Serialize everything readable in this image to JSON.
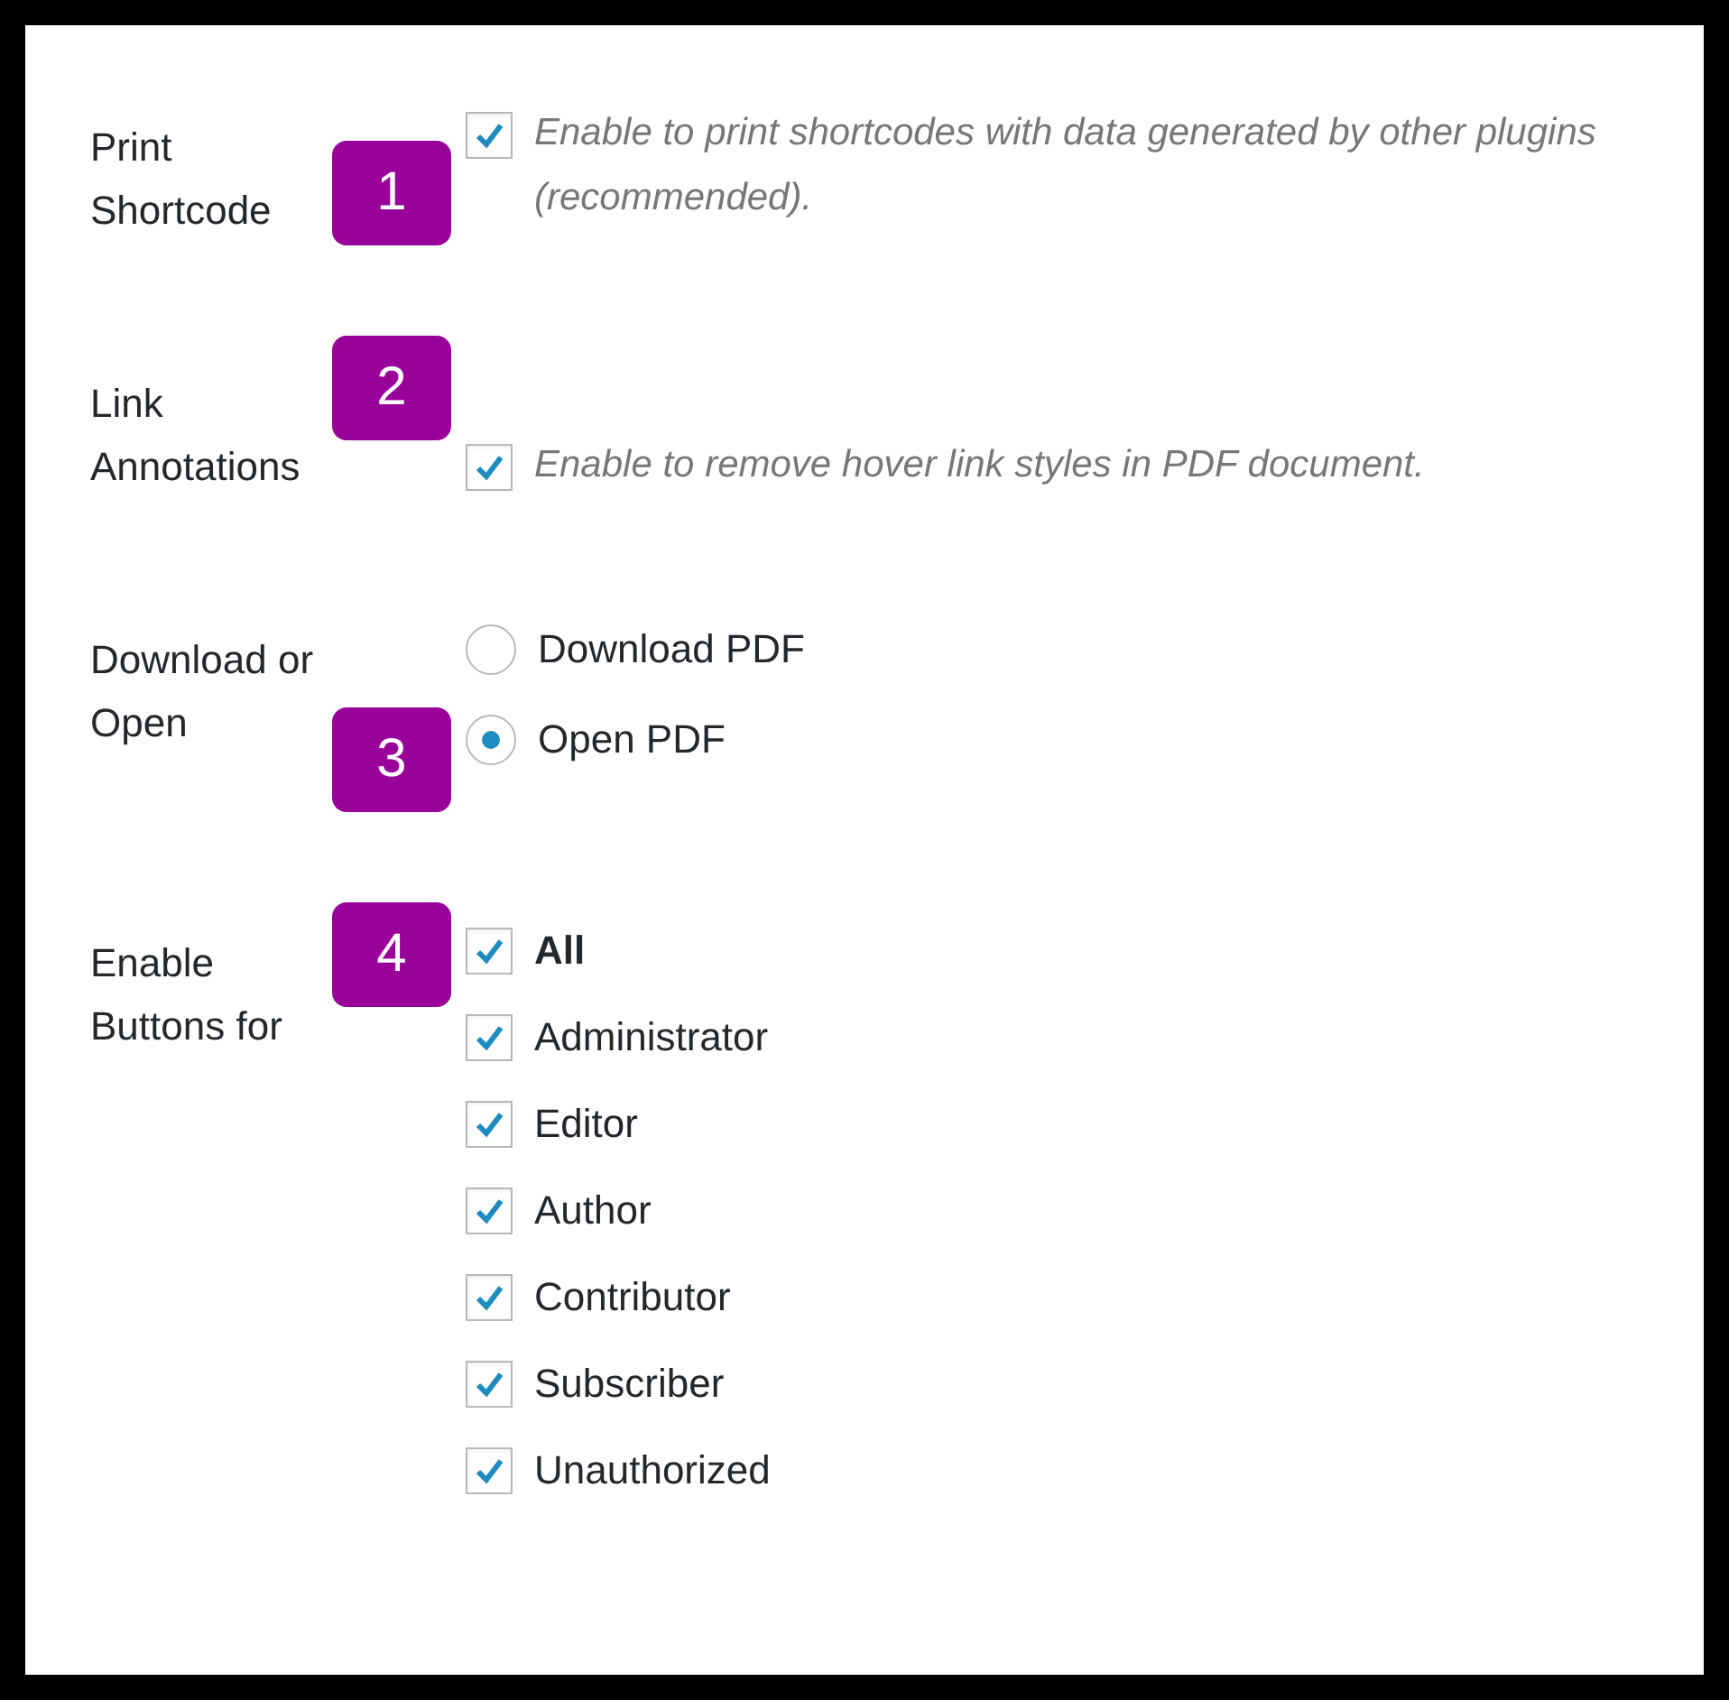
{
  "settings": [
    {
      "label": "Print Shortcode",
      "badge": "1",
      "kind": "check_note",
      "options": [
        {
          "text": "Enable to print shortcodes with data generated by other plugins (recommended).",
          "checked": true,
          "bold": false
        }
      ]
    },
    {
      "label": "Link Annotations",
      "badge": "2",
      "kind": "check_note",
      "options": [
        {
          "text": "Enable to remove hover link styles in PDF document.",
          "checked": true,
          "bold": false
        }
      ]
    },
    {
      "label": "Download or Open",
      "badge": "3",
      "kind": "radio",
      "options": [
        {
          "text": "Download PDF",
          "selected": false
        },
        {
          "text": "Open PDF",
          "selected": true
        }
      ]
    },
    {
      "label": "Enable Buttons for",
      "badge": "4",
      "kind": "check_list",
      "options": [
        {
          "text": "All",
          "checked": true,
          "bold": true
        },
        {
          "text": "Administrator",
          "checked": true,
          "bold": false
        },
        {
          "text": "Editor",
          "checked": true,
          "bold": false
        },
        {
          "text": "Author",
          "checked": true,
          "bold": false
        },
        {
          "text": "Contributor",
          "checked": true,
          "bold": false
        },
        {
          "text": "Subscriber",
          "checked": true,
          "bold": false
        },
        {
          "text": "Unauthorized",
          "checked": true,
          "bold": false
        }
      ]
    }
  ]
}
